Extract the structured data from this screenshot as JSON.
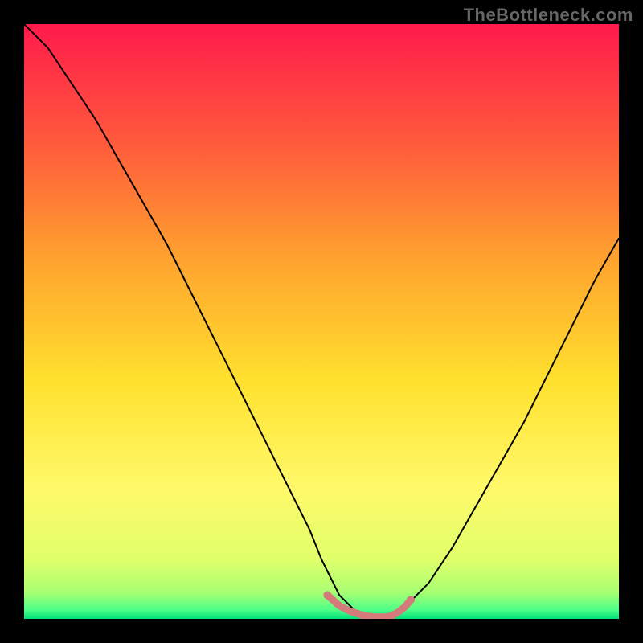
{
  "watermark": "TheBottleneck.com",
  "chart_data": {
    "type": "line",
    "title": "",
    "xlabel": "",
    "ylabel": "",
    "xlim": [
      0,
      100
    ],
    "ylim": [
      0,
      100
    ],
    "grid": false,
    "background_gradient_stops": [
      {
        "offset": 0.0,
        "color": "#ff1a4b"
      },
      {
        "offset": 0.2,
        "color": "#ff5a3c"
      },
      {
        "offset": 0.4,
        "color": "#ffa42e"
      },
      {
        "offset": 0.6,
        "color": "#ffe12e"
      },
      {
        "offset": 0.78,
        "color": "#fff96a"
      },
      {
        "offset": 0.9,
        "color": "#e0ff6a"
      },
      {
        "offset": 0.955,
        "color": "#a9ff72"
      },
      {
        "offset": 0.985,
        "color": "#4dff88"
      },
      {
        "offset": 1.0,
        "color": "#00e07a"
      }
    ],
    "series": [
      {
        "name": "bottleneck-curve",
        "stroke": "#000000",
        "x": [
          0,
          4,
          8,
          12,
          16,
          20,
          24,
          28,
          32,
          36,
          40,
          44,
          48,
          50,
          53,
          56,
          59,
          61,
          64,
          68,
          72,
          76,
          80,
          84,
          88,
          92,
          96,
          100
        ],
        "values": [
          100,
          96,
          90,
          84,
          77,
          70,
          63,
          55,
          47,
          39,
          31,
          23,
          15,
          10,
          4,
          1,
          0,
          0,
          2,
          6,
          12,
          19,
          26,
          33,
          41,
          49,
          57,
          64
        ]
      },
      {
        "name": "optimal-region-marker",
        "stroke": "#d47a7a",
        "x": [
          51,
          53,
          55,
          57,
          58,
          59,
          60,
          61,
          62,
          63,
          64,
          65
        ],
        "values": [
          4,
          2.2,
          1.2,
          0.6,
          0.4,
          0.3,
          0.3,
          0.3,
          0.6,
          1.2,
          2.0,
          3.2
        ]
      }
    ],
    "markers": {
      "series": "optimal-region-marker",
      "fill": "#d47a7a",
      "radius_px": 5,
      "points": [
        {
          "x": 51,
          "y": 4.0
        },
        {
          "x": 65,
          "y": 3.2
        }
      ]
    }
  }
}
